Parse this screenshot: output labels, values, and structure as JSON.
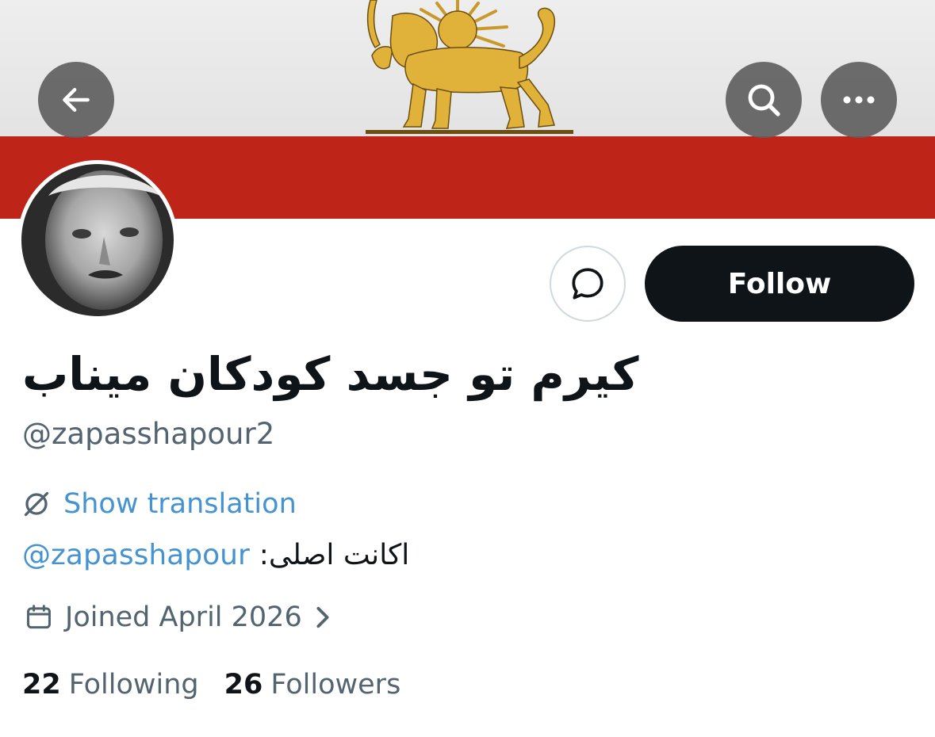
{
  "profile": {
    "display_name": "کیرم تو جسد کودکان میناب",
    "handle": "@zapasshapour2",
    "follow_label": "Follow",
    "show_translation": "Show translation",
    "bio": {
      "mention": "@zapasshapour",
      "text": "اکانت اصلی:"
    },
    "joined": "Joined April 2026",
    "following_count": "22",
    "following_label": "Following",
    "followers_count": "26",
    "followers_label": "Followers"
  },
  "icons": {
    "back": "back-arrow-icon",
    "search": "search-icon",
    "more": "more-icon",
    "message": "message-icon",
    "translate": "translate-icon",
    "calendar": "calendar-icon",
    "chevron": "chevron-right-icon"
  },
  "colors": {
    "banner_red": "#bf2419",
    "banner_light": "#e8e8e8",
    "emblem_gold": "#e0b23a",
    "follow_button_bg": "#0f1419",
    "link_blue": "#4593d0",
    "secondary_text": "#536471"
  }
}
